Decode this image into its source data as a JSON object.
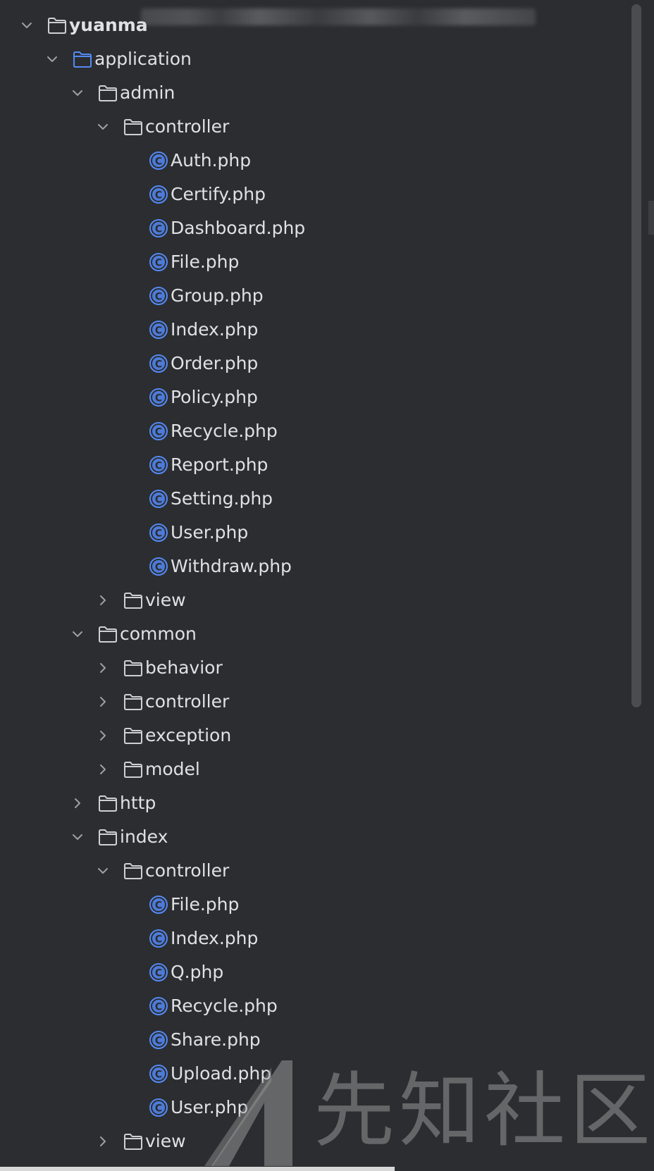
{
  "colors": {
    "background": "#2b2d30",
    "text": "#dfe1e5",
    "chevron": "#9da0a8",
    "folder_outline": "#ced0d6",
    "source_folder": "#548af7",
    "class_icon": "#548af7",
    "scrollbar_thumb": "#4a4c50"
  },
  "tree": [
    {
      "label": "yuanma",
      "depth": 0,
      "state": "expanded",
      "kind": "folder",
      "bold": true,
      "note_icon": "blurred-path"
    },
    {
      "label": "application",
      "depth": 1,
      "state": "expanded",
      "kind": "source-folder"
    },
    {
      "label": "admin",
      "depth": 2,
      "state": "expanded",
      "kind": "folder"
    },
    {
      "label": "controller",
      "depth": 3,
      "state": "expanded",
      "kind": "folder"
    },
    {
      "label": "Auth.php",
      "depth": 4,
      "state": "leaf",
      "kind": "class"
    },
    {
      "label": "Certify.php",
      "depth": 4,
      "state": "leaf",
      "kind": "class"
    },
    {
      "label": "Dashboard.php",
      "depth": 4,
      "state": "leaf",
      "kind": "class"
    },
    {
      "label": "File.php",
      "depth": 4,
      "state": "leaf",
      "kind": "class"
    },
    {
      "label": "Group.php",
      "depth": 4,
      "state": "leaf",
      "kind": "class"
    },
    {
      "label": "Index.php",
      "depth": 4,
      "state": "leaf",
      "kind": "class"
    },
    {
      "label": "Order.php",
      "depth": 4,
      "state": "leaf",
      "kind": "class"
    },
    {
      "label": "Policy.php",
      "depth": 4,
      "state": "leaf",
      "kind": "class"
    },
    {
      "label": "Recycle.php",
      "depth": 4,
      "state": "leaf",
      "kind": "class"
    },
    {
      "label": "Report.php",
      "depth": 4,
      "state": "leaf",
      "kind": "class"
    },
    {
      "label": "Setting.php",
      "depth": 4,
      "state": "leaf",
      "kind": "class"
    },
    {
      "label": "User.php",
      "depth": 4,
      "state": "leaf",
      "kind": "class"
    },
    {
      "label": "Withdraw.php",
      "depth": 4,
      "state": "leaf",
      "kind": "class"
    },
    {
      "label": "view",
      "depth": 3,
      "state": "collapsed",
      "kind": "folder"
    },
    {
      "label": "common",
      "depth": 2,
      "state": "expanded",
      "kind": "folder"
    },
    {
      "label": "behavior",
      "depth": 3,
      "state": "collapsed",
      "kind": "folder"
    },
    {
      "label": "controller",
      "depth": 3,
      "state": "collapsed",
      "kind": "folder"
    },
    {
      "label": "exception",
      "depth": 3,
      "state": "collapsed",
      "kind": "folder"
    },
    {
      "label": "model",
      "depth": 3,
      "state": "collapsed",
      "kind": "folder"
    },
    {
      "label": "http",
      "depth": 2,
      "state": "collapsed",
      "kind": "folder"
    },
    {
      "label": "index",
      "depth": 2,
      "state": "expanded",
      "kind": "folder"
    },
    {
      "label": "controller",
      "depth": 3,
      "state": "expanded",
      "kind": "folder"
    },
    {
      "label": "File.php",
      "depth": 4,
      "state": "leaf",
      "kind": "class"
    },
    {
      "label": "Index.php",
      "depth": 4,
      "state": "leaf",
      "kind": "class"
    },
    {
      "label": "Q.php",
      "depth": 4,
      "state": "leaf",
      "kind": "class"
    },
    {
      "label": "Recycle.php",
      "depth": 4,
      "state": "leaf",
      "kind": "class"
    },
    {
      "label": "Share.php",
      "depth": 4,
      "state": "leaf",
      "kind": "class"
    },
    {
      "label": "Upload.php",
      "depth": 4,
      "state": "leaf",
      "kind": "class"
    },
    {
      "label": "User.php",
      "depth": 4,
      "state": "leaf",
      "kind": "class"
    },
    {
      "label": "view",
      "depth": 3,
      "state": "collapsed",
      "kind": "folder"
    }
  ],
  "watermark": {
    "text": "先知社区",
    "logo_icon": "xianzhi-logo-icon"
  }
}
